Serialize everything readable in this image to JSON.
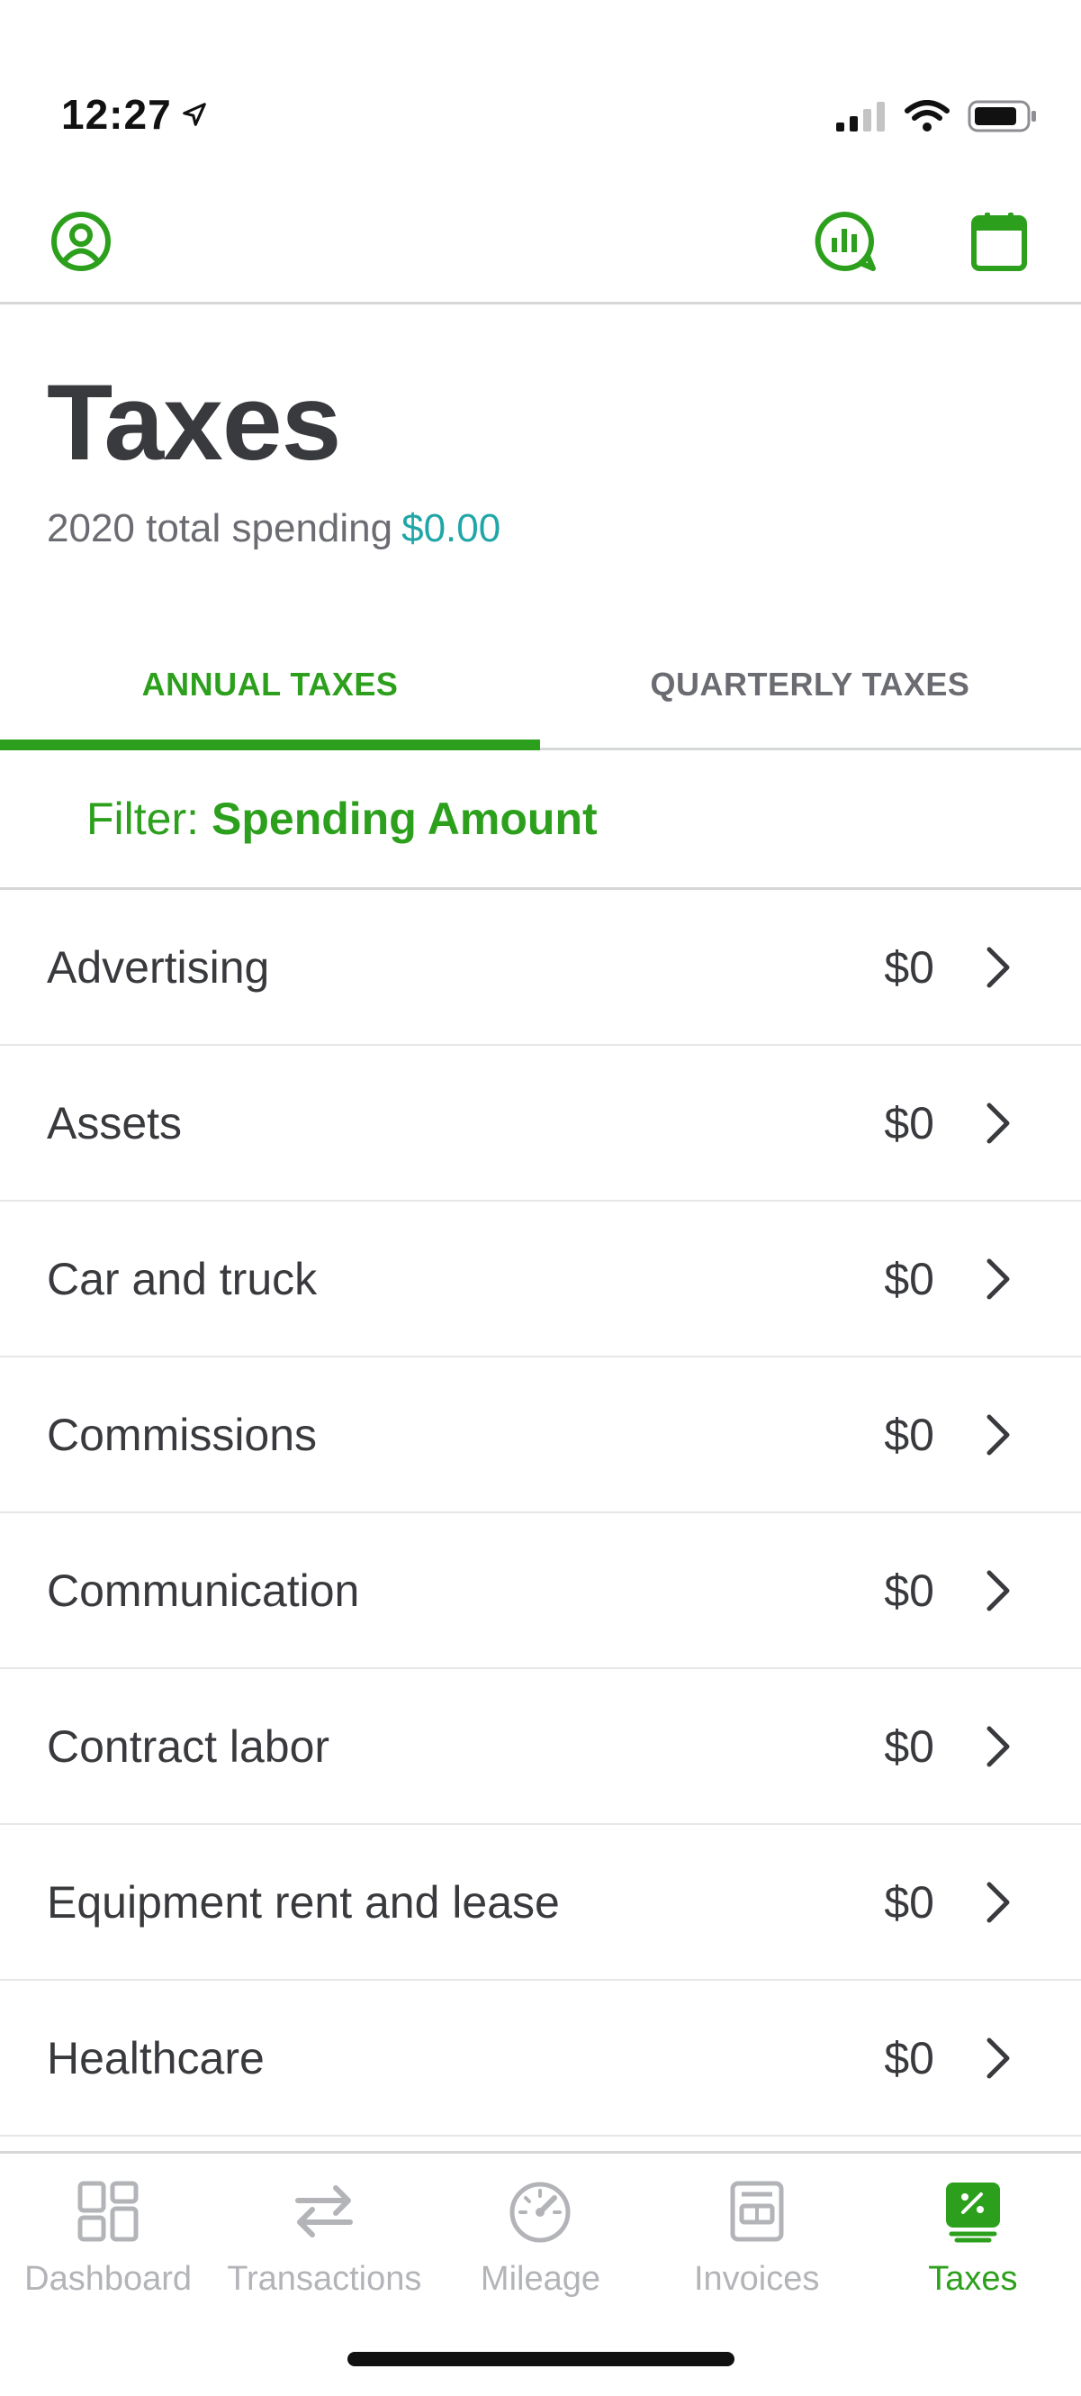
{
  "status_bar": {
    "time": "12:27",
    "icons": [
      "location-arrow-icon",
      "signal-icon",
      "wifi-icon",
      "battery-icon"
    ]
  },
  "top_nav": {
    "left_icon": "profile-icon",
    "right_icons": [
      "insights-chart-icon",
      "calendar-icon"
    ]
  },
  "header": {
    "title": "Taxes",
    "total_label": "2020 total spending",
    "total_amount": "$0.00"
  },
  "tabs": [
    {
      "label": "ANNUAL TAXES",
      "active": true
    },
    {
      "label": "QUARTERLY TAXES",
      "active": false
    }
  ],
  "filter": {
    "label": "Filter:",
    "value": "Spending Amount"
  },
  "categories": [
    {
      "label": "Advertising",
      "amount": "$0"
    },
    {
      "label": "Assets",
      "amount": "$0"
    },
    {
      "label": "Car and truck",
      "amount": "$0"
    },
    {
      "label": "Commissions",
      "amount": "$0"
    },
    {
      "label": "Communication",
      "amount": "$0"
    },
    {
      "label": "Contract labor",
      "amount": "$0"
    },
    {
      "label": "Equipment rent and lease",
      "amount": "$0"
    },
    {
      "label": "Healthcare",
      "amount": "$0"
    }
  ],
  "tab_bar": {
    "items": [
      {
        "label": "Dashboard",
        "icon": "dashboard-icon",
        "active": false
      },
      {
        "label": "Transactions",
        "icon": "transactions-icon",
        "active": false
      },
      {
        "label": "Mileage",
        "icon": "mileage-icon",
        "active": false
      },
      {
        "label": "Invoices",
        "icon": "invoices-icon",
        "active": false
      },
      {
        "label": "Taxes",
        "icon": "taxes-icon",
        "active": true
      }
    ]
  },
  "colors": {
    "brand_green": "#2ca01c",
    "amount_teal": "#21a6a8",
    "text_dark": "#393a3d",
    "text_muted": "#6b6c72",
    "inactive_icon": "#b3b4b8"
  }
}
